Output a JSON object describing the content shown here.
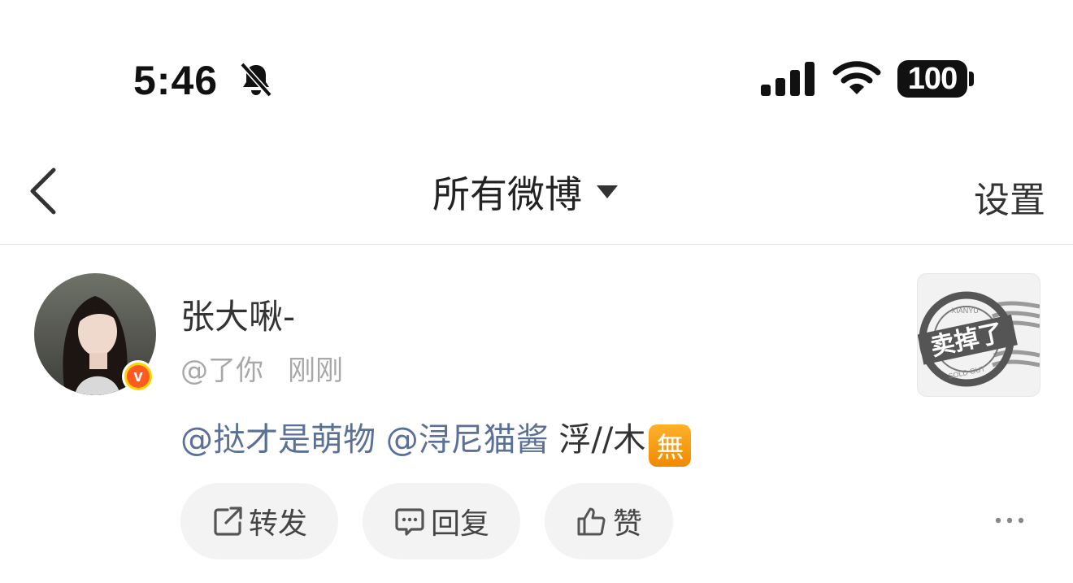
{
  "status_bar": {
    "time": "5:46",
    "battery": "100"
  },
  "nav": {
    "title": "所有微博",
    "settings_label": "设置"
  },
  "post": {
    "username": "张大啾-",
    "handle": "@了你",
    "time": "刚刚",
    "content": {
      "mention1": "@挞才是萌物",
      "mention2": "@浔尼猫酱",
      "text": " 浮//木",
      "badge": "無"
    },
    "thumbnail": {
      "stamp_text": "卖掉了",
      "stamp_top": "XIANYU",
      "stamp_bottom": "SOLD OUT"
    },
    "actions": {
      "repost": "转发",
      "reply": "回复",
      "like": "赞"
    }
  }
}
